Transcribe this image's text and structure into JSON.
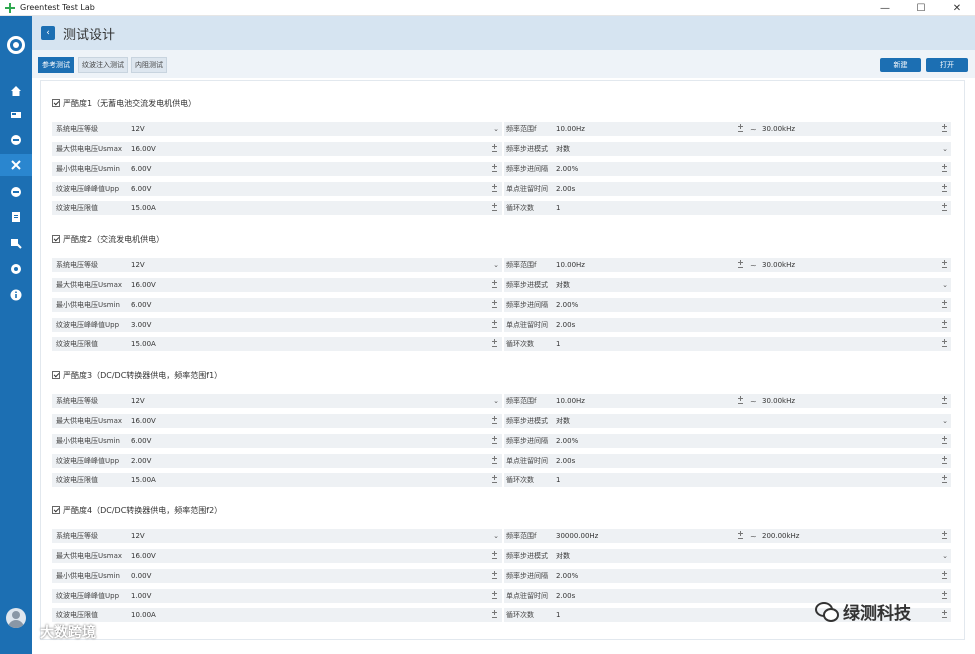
{
  "window": {
    "title": "Greentest Test Lab",
    "minimize": "—",
    "maximize": "☐",
    "close": "✕"
  },
  "header": {
    "title": "测试设计",
    "back": "‹"
  },
  "tabs": [
    "参考测试",
    "纹波注入测试",
    "内阻测试"
  ],
  "actions": {
    "new_label": "新建",
    "open_label": "打开"
  },
  "labels": {
    "system_voltage": "系统电压等级",
    "usmax": "最大供电电压Usmax",
    "usmin": "最小供电电压Usmin",
    "upp": "纹波电压峰峰值Upp",
    "current_limit": "纹波电压限值",
    "freq_range": "频率范围f",
    "step_mode": "频率步进模式",
    "step_interval": "频率步进间隔",
    "dwell_time": "单点驻留时间",
    "cycles": "循环次数"
  },
  "sections": [
    {
      "title": "严酷度1（无蓄电池交流发电机供电）",
      "system_voltage": "12V",
      "usmax": "16.00V",
      "usmin": "6.00V",
      "upp": "6.00V",
      "current_limit": "15.00A",
      "freq_from": "10.00Hz",
      "freq_to": "30.00kHz",
      "step_mode": "对数",
      "step_interval": "2.00%",
      "dwell_time": "2.00s",
      "cycles": "1"
    },
    {
      "title": "严酷度2（交流发电机供电）",
      "system_voltage": "12V",
      "usmax": "16.00V",
      "usmin": "6.00V",
      "upp": "3.00V",
      "current_limit": "15.00A",
      "freq_from": "10.00Hz",
      "freq_to": "30.00kHz",
      "step_mode": "对数",
      "step_interval": "2.00%",
      "dwell_time": "2.00s",
      "cycles": "1"
    },
    {
      "title": "严酷度3（DC/DC转换器供电，频率范围f1）",
      "system_voltage": "12V",
      "usmax": "16.00V",
      "usmin": "6.00V",
      "upp": "2.00V",
      "current_limit": "15.00A",
      "freq_from": "10.00Hz",
      "freq_to": "30.00kHz",
      "step_mode": "对数",
      "step_interval": "2.00%",
      "dwell_time": "2.00s",
      "cycles": "1"
    },
    {
      "title": "严酷度4（DC/DC转换器供电，频率范围f2）",
      "system_voltage": "12V",
      "usmax": "16.00V",
      "usmin": "0.00V",
      "upp": "1.00V",
      "current_limit": "10.00A",
      "freq_from": "30000.00Hz",
      "freq_to": "200.00kHz",
      "step_mode": "对数",
      "step_interval": "2.00%",
      "dwell_time": "2.00s",
      "cycles": "1"
    }
  ],
  "watermarks": {
    "left": "大数跨境",
    "right": "绿测科技"
  },
  "colors": {
    "accent": "#1c6fb3",
    "header_bg": "#d6e4f1",
    "field_bg": "#eef1f4"
  }
}
